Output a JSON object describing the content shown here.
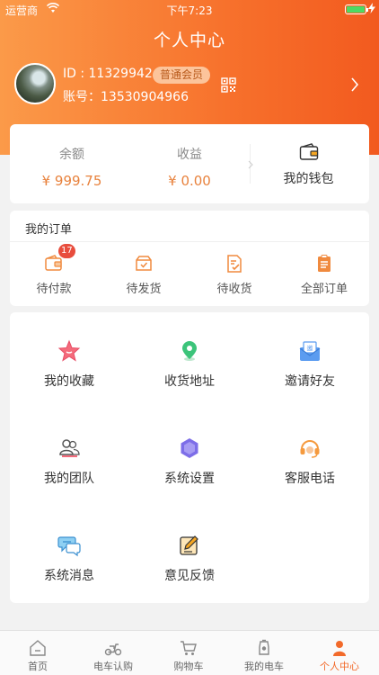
{
  "status_bar": {
    "carrier": "运营商",
    "time": "下午7:23"
  },
  "header": {
    "title": "个人中心"
  },
  "profile": {
    "id_text": "ID : 11329942",
    "member_badge": "普通会员",
    "account_text": "账号：13530904966"
  },
  "wallet": {
    "balance_label": "余额",
    "balance_value": "¥ 999.75",
    "earnings_label": "收益",
    "earnings_value": "¥ 0.00",
    "my_wallet_label": "我的钱包"
  },
  "orders": {
    "title": "我的订单",
    "items": [
      {
        "label": "待付款",
        "icon": "wallet-pending-icon",
        "badge": "17"
      },
      {
        "label": "待发货",
        "icon": "box-ship-icon"
      },
      {
        "label": "待收货",
        "icon": "receive-doc-icon"
      },
      {
        "label": "全部订单",
        "icon": "clipboard-icon"
      }
    ]
  },
  "services": [
    {
      "label": "我的收藏",
      "icon": "star-icon"
    },
    {
      "label": "收货地址",
      "icon": "location-pin-icon"
    },
    {
      "label": "邀请好友",
      "icon": "invite-envelope-icon"
    },
    {
      "label": "我的团队",
      "icon": "team-icon"
    },
    {
      "label": "系统设置",
      "icon": "settings-hexagon-icon"
    },
    {
      "label": "客服电话",
      "icon": "headset-icon"
    },
    {
      "label": "系统消息",
      "icon": "chat-bubbles-icon"
    },
    {
      "label": "意见反馈",
      "icon": "feedback-edit-icon"
    }
  ],
  "tabbar": [
    {
      "label": "首页",
      "icon": "home-icon"
    },
    {
      "label": "电车认购",
      "icon": "scooter-icon"
    },
    {
      "label": "购物车",
      "icon": "cart-icon"
    },
    {
      "label": "我的电车",
      "icon": "ebike-icon"
    },
    {
      "label": "个人中心",
      "icon": "person-icon",
      "active": true
    }
  ],
  "colors": {
    "accent": "#f7712c",
    "price": "#e8823d",
    "badge_red": "#e84d3d"
  }
}
